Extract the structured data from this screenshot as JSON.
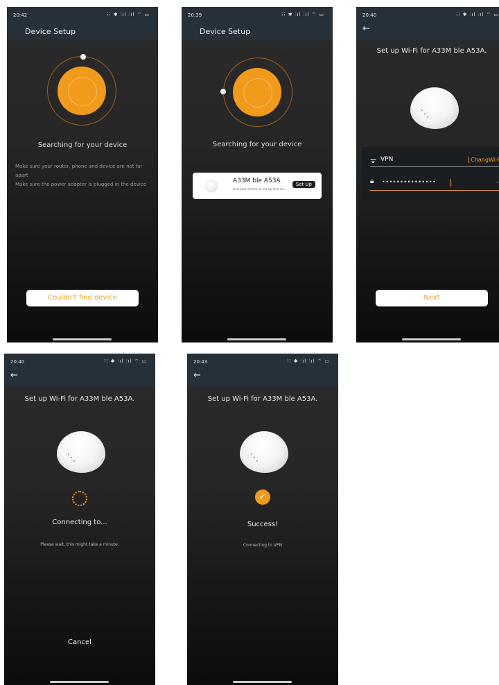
{
  "screens": [
    {
      "time": "20:42",
      "status_icons": "⁝⁝ ✱ ⫶ıl ⫶ıl ⌔ ▭",
      "title": "Device Setup",
      "heading": "Searching for your device",
      "tips": [
        "Make sure your router, phone and device are not far apart",
        "Make sure the power adapter is plugged in the device"
      ],
      "button_label": "Couldn't find device"
    },
    {
      "time": "20:39",
      "status_icons": "⁝⁝ ✱ ⫶ıl ⫶ıl ⌔ ▭",
      "title": "Device Setup",
      "heading": "Searching for your device",
      "device_card": {
        "name": "A33M ble A53A",
        "subtitle": "Use your Phone to set up this A3...",
        "button_label": "Set Up"
      }
    },
    {
      "time": "20:40",
      "status_icons": "⁝⁝ ✱ ⫶ıl ⫶ıl ⌔ ▭",
      "back_icon": "arrow-left-icon",
      "heading": "Set up Wi-Fi for A33M ble A53A.",
      "wifi_label": "VPN",
      "ssid_value": "ChangWi-Fi",
      "password_value": "•••••••••••••••",
      "button_label": "Next"
    },
    {
      "time": "20:40",
      "status_icons": "⁝⁝ ✱ ⫶ıl ⫶ıl ⌔ ▭",
      "heading": "Set up Wi-Fi for A33M ble A53A.",
      "status_text": "Connecting to...",
      "sub_text": "Please wait, this might take a minute.",
      "button_label": "Cancel"
    },
    {
      "time": "20:43",
      "status_icons": "⁝⁝ ✱ ⫶ıl ⫶ıl ⌔ ▭",
      "heading": "Set up Wi-Fi for A33M ble A53A.",
      "status_text": "Success!",
      "sub_text": "Connecting to VPN"
    }
  ],
  "colors": {
    "accent": "#f29a1a",
    "header_bg": "#253038",
    "panel_bg": "#262626"
  }
}
